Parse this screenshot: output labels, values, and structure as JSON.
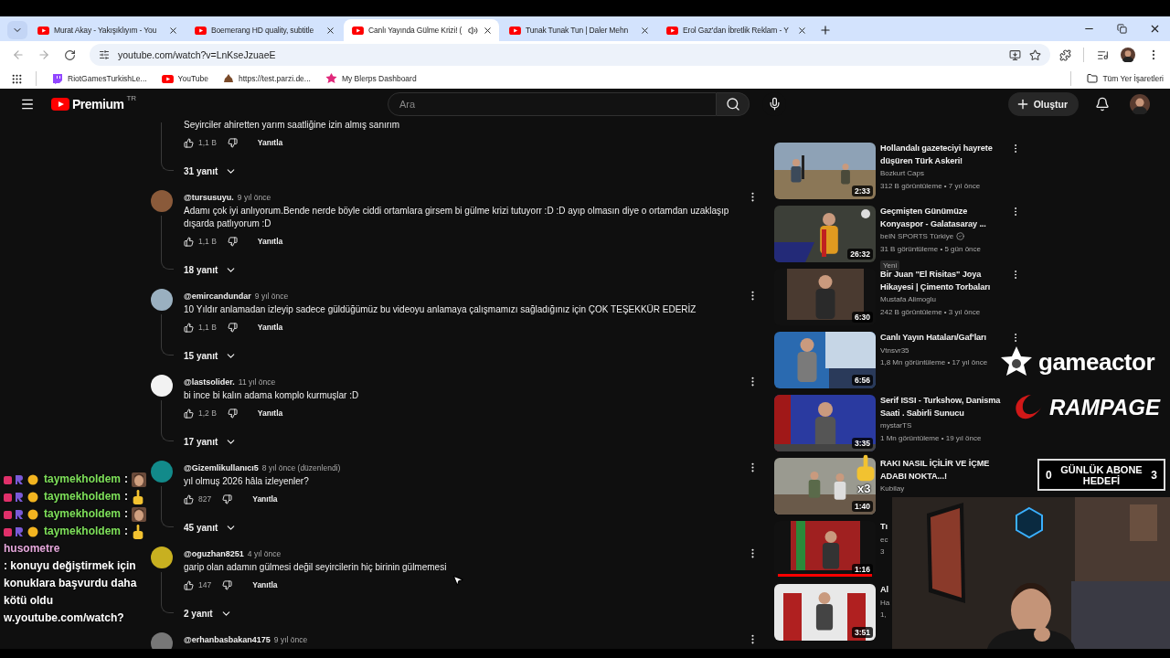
{
  "browser": {
    "tabs": [
      {
        "title": "Murat Akay - Yakışıklıyım - You",
        "selected": false,
        "audio": false
      },
      {
        "title": "Boemerang HD quality, subtitle",
        "selected": false,
        "audio": false
      },
      {
        "title": "Canlı Yayında Gülme Krizi! (",
        "selected": true,
        "audio": true
      },
      {
        "title": "Tunak Tunak Tun | Daler Mehn",
        "selected": false,
        "audio": false
      },
      {
        "title": "Erol Gaz'dan İbretlik Reklam - Y",
        "selected": false,
        "audio": false
      }
    ],
    "address": "youtube.com/watch?v=LnKseJzuaeE",
    "bookmarks": [
      {
        "label": "RiotGamesTurkishLe...",
        "kind": "twitch"
      },
      {
        "label": "YouTube",
        "kind": "youtube"
      },
      {
        "label": "https://test.parzi.de...",
        "kind": "pile"
      },
      {
        "label": "My Blerps Dashboard",
        "kind": "blerp"
      }
    ],
    "all_bookmarks": "Tüm Yer İşaretleri"
  },
  "youtube": {
    "logo": "Premium",
    "region": "TR",
    "search": {
      "placeholder": "Ara"
    },
    "create": "Oluştur",
    "comments": [
      {
        "text": "Seyirciler ahiretten yarım saatliğine izin almış sanırım",
        "likes": "1,1 B",
        "reply_label": "Yanıtla",
        "replies": "31 yanıt"
      },
      {
        "author": "@tursusuyu.",
        "time": "9 yıl önce",
        "text": "Adamı çok iyi anlıyorum.Bende nerde böyle ciddi ortamlara girsem bi gülme krizi tutuyorr :D :D ayıp olmasın diye o ortamdan uzaklaşıp dışarda patlıyorum :D",
        "likes": "1,1 B",
        "reply_label": "Yanıtla",
        "replies": "18 yanıt"
      },
      {
        "author": "@emircandundar",
        "time": "9 yıl önce",
        "text": "10 Yıldır anlamadan izleyip sadece güldüğümüz bu videoyu anlamaya çalışmamızı sağladığınız için ÇOK TEŞEKKÜR EDERİZ",
        "likes": "1,1 B",
        "reply_label": "Yanıtla",
        "replies": "15 yanıt"
      },
      {
        "author": "@lastsolider.",
        "time": "11 yıl önce",
        "text": "bi ince bi kalın adama komplo kurmuşlar :D",
        "likes": "1,2 B",
        "reply_label": "Yanıtla",
        "replies": "17 yanıt"
      },
      {
        "author": "@Gizemlikullanıcı5",
        "time": "8 yıl önce (düzenlendi)",
        "text": "yıl olmuş 2026 hâla izleyenler?",
        "likes": "827",
        "reply_label": "Yanıtla",
        "replies": "45 yanıt"
      },
      {
        "author": "@oguzhan8251",
        "time": "4 yıl önce",
        "text": "garip olan adamın gülmesi değil seyircilerin hiç birinin gülmemesi",
        "likes": "147",
        "reply_label": "Yanıtla",
        "replies": "2 yanıt"
      },
      {
        "author": "@erhanbasbakan4175",
        "time": "9 yıl önce"
      }
    ],
    "related": [
      {
        "title": "Hollandalı gazeteciyi hayrete düşüren Türk Askeri!",
        "channel": "Bozkurt Caps",
        "meta": "312 B görüntüleme • 7 yıl önce",
        "duration": "2:33",
        "menu": true
      },
      {
        "title": "Geçmişten Günümüze Konyaspor - Galatasaray ...",
        "channel": "beIN SPORTS Türkiye",
        "verified": true,
        "meta": "31 B görüntüleme • 5 gün önce",
        "badge": "Yeni",
        "duration": "26:32",
        "menu": true
      },
      {
        "title": "Bir Juan \"El Risitas\" Joya Hikayesi | Çimento Torbaları",
        "channel": "Mustafa Alimoglu",
        "meta": "242 B görüntüleme • 3 yıl önce",
        "duration": "6:30",
        "menu": true
      },
      {
        "title": "Canlı Yayın Hataları/Gaf'ları",
        "channel": "Vtnsvr35",
        "meta": "1,8 Mn görüntüleme • 17 yıl önce",
        "duration": "6:56",
        "menu": true
      },
      {
        "title": "Serif ISSI - Turkshow, Danisma Saati . Sabirli Sunucu",
        "channel": "mystarTS",
        "meta": "1 Mn görüntüleme • 19 yıl önce",
        "duration": "3:35"
      },
      {
        "title": "RAKI NASIL İÇİLİR VE İÇME ADABI NOKTA...!",
        "channel": "Kubilay",
        "duration": "1:40"
      },
      {
        "title": "Tı",
        "channel": "ec",
        "meta": "3",
        "duration": "1:16",
        "level": 1
      },
      {
        "title": "Al",
        "channel": "Ha",
        "meta": "1,",
        "duration": "3:51"
      }
    ]
  },
  "stream": {
    "chat": [
      {
        "kind": "emote",
        "user": "taymekholdem",
        "color": "#7ee05a",
        "badges": true,
        "text": ":",
        "emote": {
          "kind": "face"
        }
      },
      {
        "kind": "emote",
        "user": "taymekholdem",
        "color": "#7ee05a",
        "badges": true,
        "text": ":",
        "emote": {
          "kind": "hand"
        }
      },
      {
        "kind": "emote",
        "user": "taymekholdem",
        "color": "#7ee05a",
        "badges": true,
        "text": ":",
        "emote": {
          "kind": "face"
        }
      },
      {
        "kind": "emote",
        "user": "taymekholdem",
        "color": "#7ee05a",
        "badges": true,
        "text": ":",
        "emote": {
          "kind": "hand"
        }
      },
      {
        "kind": "message",
        "user": "husometre",
        "color": "#e6a8dc",
        "text": ": konuyu değiştirmek için konuklara başvurdu daha kötü oldu"
      },
      {
        "kind": "fragment",
        "text": "w.youtube.com/watch?"
      }
    ],
    "sponsors": [
      {
        "kind": "star",
        "name": "gameactor"
      },
      {
        "kind": "swoosh",
        "name": "RAMPAGE"
      }
    ],
    "goal": {
      "current": "0",
      "title": "GÜNLÜK ABONE HEDEFİ",
      "target": "3"
    },
    "sticker": {
      "count": "x3"
    }
  }
}
